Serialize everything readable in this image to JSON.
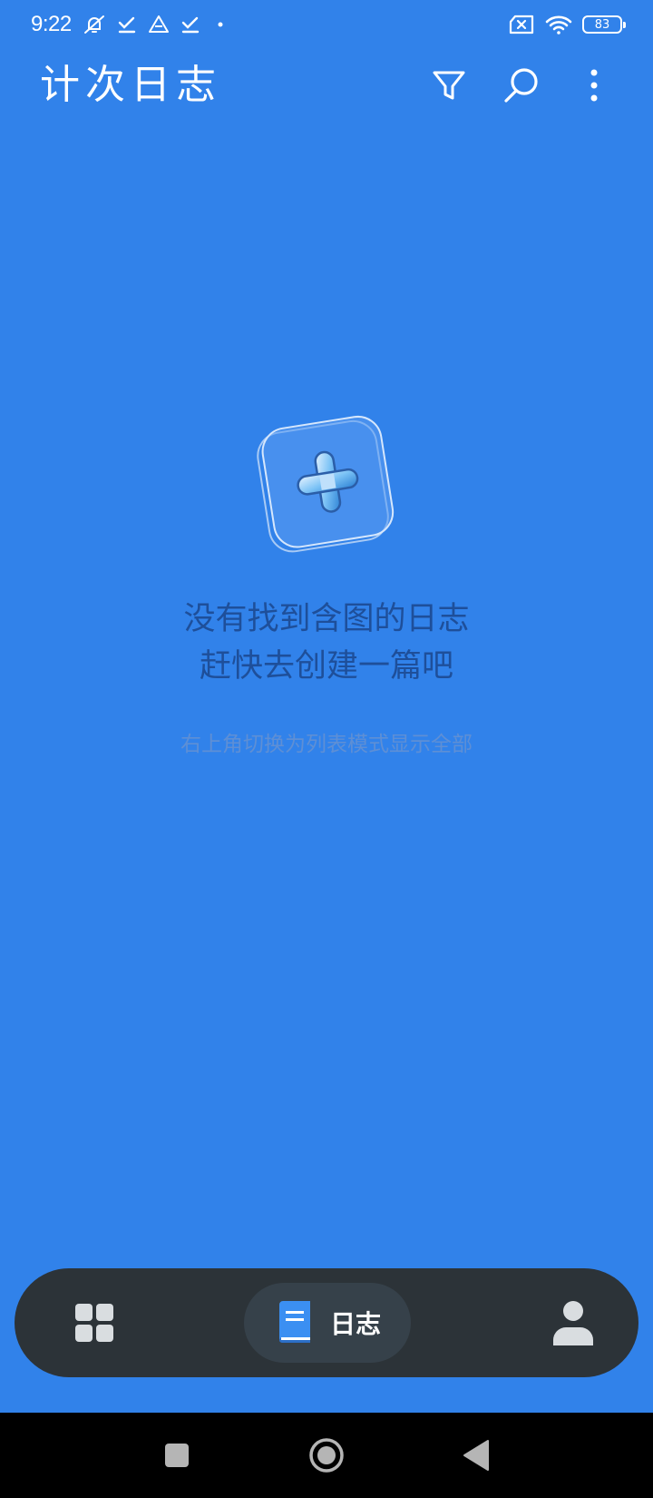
{
  "status_bar": {
    "time": "9:22",
    "battery": "83",
    "icons": [
      "bell-off-icon",
      "check-icon",
      "drive-icon",
      "check-icon",
      "dot-icon",
      "sim-x-icon",
      "wifi-icon",
      "battery-icon"
    ]
  },
  "app_bar": {
    "title": "计次日志",
    "actions": [
      "filter-icon",
      "search-icon",
      "more-vertical-icon"
    ]
  },
  "empty_state": {
    "icon": "add-icon",
    "title_line1": "没有找到含图的日志",
    "title_line2": "赶快去创建一篇吧",
    "hint": "右上角切换为列表模式显示全部"
  },
  "bottom_nav": {
    "items": [
      {
        "icon": "grid-icon",
        "label": ""
      },
      {
        "icon": "journal-icon",
        "label": "日志",
        "active": true
      },
      {
        "icon": "person-icon",
        "label": ""
      }
    ]
  },
  "colors": {
    "background": "#3182EA",
    "nav_bar": "#2C3338",
    "nav_active_pill": "#36414a",
    "title_text": "#1e4f9a",
    "hint_text": "#5e8fd5",
    "accent": "#3182EA"
  }
}
